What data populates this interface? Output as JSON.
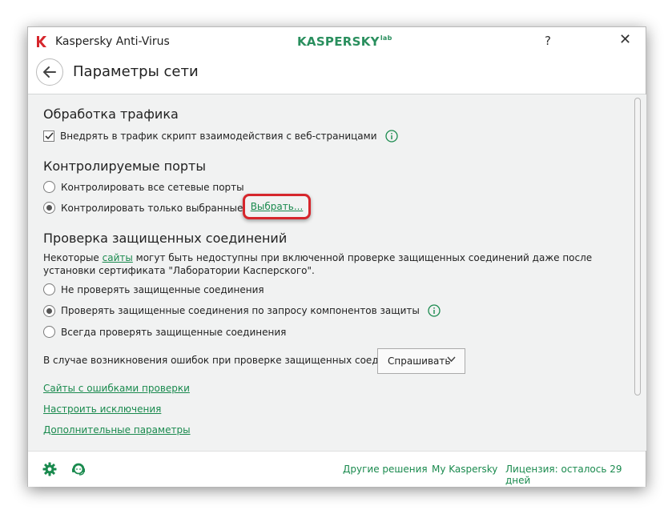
{
  "window": {
    "app_title": "Kaspersky Anti-Virus",
    "brand": "KASPERSKY",
    "brand_suffix": "lab",
    "help_label": "?",
    "close_label": "✕"
  },
  "header": {
    "title": "Параметры сети"
  },
  "traffic": {
    "title": "Обработка трафика",
    "inject_script_label": "Внедрять в трафик скрипт взаимодействия с веб-страницами",
    "inject_script_checked": true
  },
  "ports": {
    "title": "Контролируемые порты",
    "option_all": "Контролировать все сетевые порты",
    "option_selected": "Контролировать только выбранные порты",
    "selected_option": "selected",
    "choose_link": "Выбрать..."
  },
  "secure": {
    "title": "Проверка защищенных соединений",
    "note_before": "Некоторые ",
    "note_link": "сайты",
    "note_after": " могут быть недоступны при включенной проверке защищенных соединений даже после установки сертификата \"Лаборатории Касперского\".",
    "option_none": "Не проверять защищенные соединения",
    "option_on_request": "Проверять защищенные соединения по запросу компонентов защиты",
    "option_always": "Всегда проверять защищенные соединения",
    "selected_option": "on_request",
    "errors_label": "В случае возникновения ошибок при проверке защищенных соединений:",
    "errors_value": "Спрашивать"
  },
  "links": {
    "sites_with_errors": "Сайты с ошибками проверки",
    "configure_exclusions": "Настроить исключения",
    "advanced": "Дополнительные параметры"
  },
  "footer": {
    "other_solutions": "Другие решения",
    "my_kaspersky": "My Kaspersky",
    "license": "Лицензия: осталось 29 дней"
  },
  "colors": {
    "accent_green": "#1a8a4e",
    "highlight_red": "#d6262c",
    "content_bg": "#f1f2f2"
  }
}
